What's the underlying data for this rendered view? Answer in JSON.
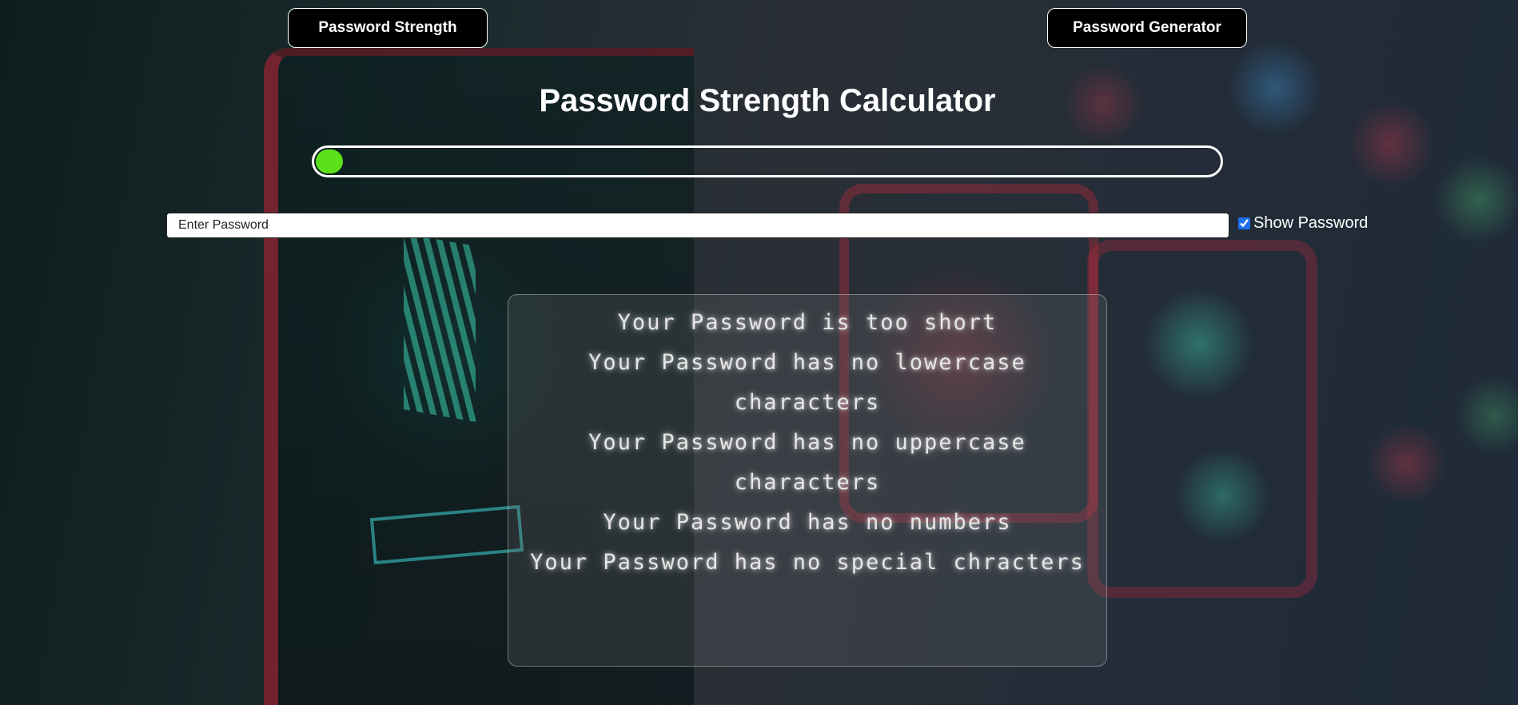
{
  "nav": {
    "strength_label": "Password Strength",
    "generator_label": "Password Generator"
  },
  "title": "Password Strength Calculator",
  "meter": {
    "strength_fraction": 0.03,
    "fill_color": "#5be01a"
  },
  "password_input": {
    "placeholder": "Enter Password",
    "value": ""
  },
  "show_password": {
    "label": "Show Password",
    "checked": true
  },
  "feedback": {
    "messages": [
      "Your Password is too short",
      "Your Password has no lowercase characters",
      "Your Password has no uppercase characters",
      "Your Password has no numbers",
      "Your Password has no special chracters"
    ]
  }
}
